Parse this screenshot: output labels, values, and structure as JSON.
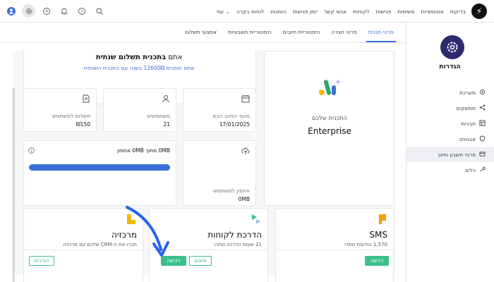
{
  "topbar": {
    "nav": [
      "בדיקות",
      "אוטומציות",
      "משימות",
      "פגישות",
      "לקוחות",
      "אנשי קשר",
      "יומן פגישות",
      "הזמנות",
      "לוחות בקרה"
    ],
    "more_label": "עוד"
  },
  "sidebar": {
    "title": "הגדרות",
    "items": [
      {
        "label": "מערכת",
        "icon": "settings-icon"
      },
      {
        "label": "ממשקים",
        "icon": "share-icon"
      },
      {
        "label": "תבניות",
        "icon": "template-icon"
      },
      {
        "label": "אבטחה",
        "icon": "shield-icon"
      },
      {
        "label": "פרטי חשבון וחיוב",
        "icon": "card-icon"
      },
      {
        "label": "כלים",
        "icon": "tools-icon"
      }
    ]
  },
  "tabs": [
    "פרטי תכנית",
    "פרטי חברה",
    "היסטוריית חיובים",
    "היסטוריית חשבוניות",
    "אמצעי תשלום"
  ],
  "plan": {
    "label": "התכנית שלכם",
    "name": "Enterprise"
  },
  "billing": {
    "title_prefix": "אתם ",
    "title_bold": "בתכנית תשלום שנתית",
    "savings": "אתם חוסכים 12600₪ בשנה עם התכנית השנתית"
  },
  "stats": [
    {
      "label": "מועד החיוב הבא",
      "value": "17/01/2025",
      "icon": "calendar-icon"
    },
    {
      "label": "משתמשים",
      "value": "21",
      "icon": "user-icon"
    },
    {
      "label": "תשלום למשתמש",
      "value": "₪150",
      "icon": "invoice-icon"
    }
  ],
  "storage_user": {
    "label": "אחסון למשתמש",
    "value": "0MB",
    "icon": "cloud-upload-icon"
  },
  "storage_total": {
    "text": "0MB מתוך 0MB אחסון",
    "percent": 100,
    "icon": "info-icon"
  },
  "addons": [
    {
      "name": "SMS",
      "subtitle": "1,570 הודעות נותרו",
      "buttons": [
        "רכישה"
      ],
      "icon": "sms-icon"
    },
    {
      "name": "הדרכת לקוחות",
      "subtitle": "21 שעות הדרכה נותרו",
      "buttons": [
        "רכישה",
        "תיאום"
      ],
      "icon": "training-icon"
    },
    {
      "name": "מרכזיה",
      "subtitle": "חברו את ה-CRM שלכם עם מרכזיה",
      "buttons": [
        "הגדרות"
      ],
      "icon": "pbx-icon"
    }
  ],
  "colors": {
    "accent": "#3b6fd8",
    "green": "#3cc08b",
    "brand": "#2d2a6e",
    "annotation": "#2563eb"
  }
}
